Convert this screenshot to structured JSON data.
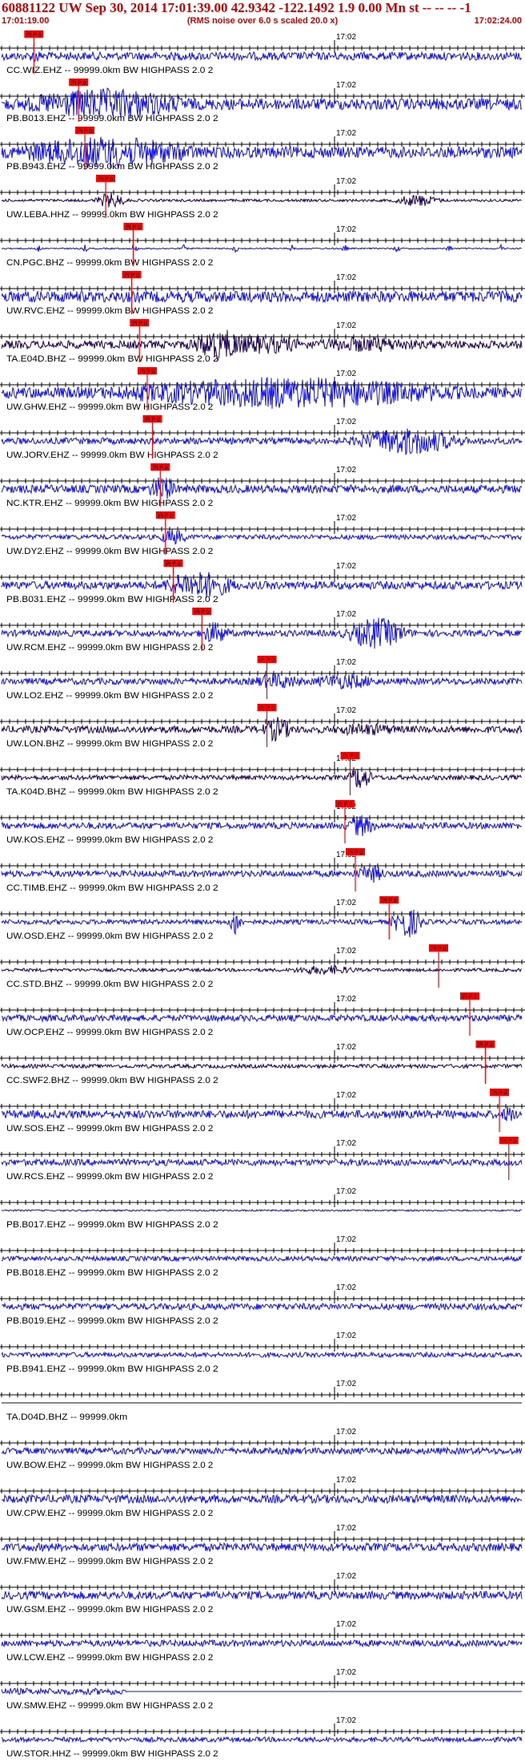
{
  "header": {
    "title": "60881122 UW Sep 30, 2014 17:01:39.00   42.9342 -122.1492  1.9 0.00 Mn st -- -- -- -1",
    "start_time": "17:01:19.00",
    "noise_note": "(RMS noise over 6.0 s scaled 20.0 x)",
    "end_time": "17:02:24.00"
  },
  "chart_data": {
    "type": "line",
    "title": "60881122 UW Sep 30, 2014 17:01:39.00   42.9342 -122.1492  1.9 0.00 Mn st -- -- -- -1",
    "x_start": "17:01:19.00",
    "x_end": "17:02:24.00",
    "x_mark": "17:02",
    "pick_label": "Pi P 0",
    "colors": {
      "trace": "#1010ee",
      "trace_dark": "#1a0055",
      "pick": "#ff0000",
      "axis": "#000000",
      "text": "#000000"
    },
    "traces": [
      {
        "label": "CC.WIZ.EHZ -- 99999.0km BW HIGHPASS 2.0 2",
        "color": "blue",
        "pick": 0.062,
        "amp": 0.25,
        "events": [
          [
            0.065,
            0.45,
            0.01
          ]
        ]
      },
      {
        "label": "PB.B013.EHZ -- 99999.0km BW HIGHPASS 2.0 2",
        "color": "blue",
        "pick": 0.148,
        "amp": 0.35,
        "events": [
          [
            0.2,
            1.0,
            0.12
          ]
        ]
      },
      {
        "label": "PB.B943.EHZ -- 99999.0km BW HIGHPASS 2.0 2",
        "color": "blue",
        "pick": 0.16,
        "amp": 0.35,
        "events": [
          [
            0.2,
            1.0,
            0.13
          ]
        ]
      },
      {
        "label": "UW.LEBA.HHZ -- 99999.0km BW HIGHPASS 2.0 2",
        "color": "dark",
        "pick": 0.2,
        "amp": 0.08,
        "events": [
          [
            0.21,
            0.5,
            0.02
          ],
          [
            0.8,
            0.4,
            0.03
          ]
        ]
      },
      {
        "label": "CN.PGC.BHZ -- 99999.0km BW HIGHPASS 2.0 2",
        "color": "blue",
        "pick": 0.253,
        "amp": 0.04,
        "events": [
          [
            0.07,
            0.25,
            0.004
          ],
          [
            0.16,
            0.25,
            0.004
          ],
          [
            0.255,
            0.35,
            0.004
          ],
          [
            0.35,
            0.25,
            0.004
          ],
          [
            0.45,
            0.25,
            0.004
          ],
          [
            0.56,
            0.25,
            0.004
          ],
          [
            0.66,
            0.25,
            0.004
          ],
          [
            0.76,
            0.25,
            0.004
          ],
          [
            0.86,
            0.25,
            0.004
          ],
          [
            0.96,
            0.25,
            0.004
          ]
        ]
      },
      {
        "label": "UW.RVC.EHZ -- 99999.0km BW HIGHPASS 2.0 2",
        "color": "blue",
        "pick": 0.25,
        "amp": 0.35,
        "events": []
      },
      {
        "label": "TA.E04D.BHZ -- 99999.0km BW HIGHPASS 2.0 2",
        "color": "dark",
        "pick": 0.265,
        "amp": 0.25,
        "events": [
          [
            0.42,
            1.0,
            0.04
          ],
          [
            0.5,
            0.6,
            0.07
          ],
          [
            0.7,
            0.5,
            0.09
          ]
        ]
      },
      {
        "label": "UW.GHW.EHZ -- 99999.0km BW HIGHPASS 2.0 2",
        "color": "blue",
        "pick": 0.28,
        "amp": 0.35,
        "events": [
          [
            0.55,
            1.0,
            0.25
          ]
        ]
      },
      {
        "label": "UW.JORV.EHZ -- 99999.0km BW HIGHPASS 2.0 2",
        "color": "blue",
        "pick": 0.29,
        "amp": 0.2,
        "events": [
          [
            0.78,
            0.9,
            0.07
          ]
        ]
      },
      {
        "label": "NC.KTR.EHZ -- 99999.0km BW HIGHPASS 2.0 2",
        "color": "blue",
        "pick": 0.305,
        "amp": 0.25,
        "events": [
          [
            0.31,
            0.8,
            0.02
          ]
        ]
      },
      {
        "label": "UW.DY2.EHZ -- 99999.0km BW HIGHPASS 2.0 2",
        "color": "blue",
        "pick": 0.315,
        "amp": 0.15,
        "events": [
          [
            0.33,
            0.5,
            0.02
          ]
        ]
      },
      {
        "label": "PB.B031.EHZ -- 99999.0km BW HIGHPASS 2.0 2",
        "color": "blue",
        "pick": 0.33,
        "amp": 0.25,
        "events": [
          [
            0.38,
            0.9,
            0.05
          ]
        ]
      },
      {
        "label": "UW.RCM.EHZ -- 99999.0km BW HIGHPASS 2.0 2",
        "color": "blue",
        "pick": 0.385,
        "amp": 0.2,
        "events": [
          [
            0.41,
            0.7,
            0.02
          ],
          [
            0.72,
            1.0,
            0.04
          ]
        ]
      },
      {
        "label": "UW.LO2.EHZ -- 99999.0km BW HIGHPASS 2.0 2",
        "color": "blue",
        "pick": 0.51,
        "amp": 0.2,
        "events": [
          [
            0.53,
            0.5,
            0.04
          ],
          [
            0.66,
            0.5,
            0.05
          ]
        ]
      },
      {
        "label": "UW.LON.BHZ -- 99999.0km BW HIGHPASS 2.0 2",
        "color": "dark",
        "pick": 0.51,
        "amp": 0.22,
        "events": [
          [
            0.53,
            0.8,
            0.02
          ],
          [
            0.7,
            0.4,
            0.06
          ]
        ]
      },
      {
        "label": "TA.K04D.BHZ -- 99999.0km BW HIGHPASS 2.0 2",
        "color": "dark",
        "pick": 0.67,
        "amp": 0.15,
        "events": [
          [
            0.69,
            0.8,
            0.015
          ]
        ]
      },
      {
        "label": "UW.KOS.EHZ -- 99999.0km BW HIGHPASS 2.0 2",
        "color": "blue",
        "pick": 0.66,
        "amp": 0.2,
        "events": [
          [
            0.69,
            0.7,
            0.02
          ]
        ]
      },
      {
        "label": "CC.TIMB.EHZ -- 99999.0km BW HIGHPASS 2.0 2",
        "color": "blue",
        "pick": 0.68,
        "amp": 0.2,
        "events": [
          [
            0.71,
            0.6,
            0.02
          ]
        ]
      },
      {
        "label": "UW.OSD.EHZ -- 99999.0km BW HIGHPASS 2.0 2",
        "color": "blue",
        "pick": 0.745,
        "amp": 0.15,
        "events": [
          [
            0.45,
            0.9,
            0.008
          ],
          [
            0.78,
            1.0,
            0.02
          ]
        ]
      },
      {
        "label": "CC.STD.BHZ -- 99999.0km BW HIGHPASS 2.0 2",
        "color": "dark",
        "pick": 0.84,
        "amp": 0.1,
        "events": [
          [
            0.62,
            0.3,
            0.05
          ]
        ]
      },
      {
        "label": "UW.OCP.EHZ -- 99999.0km BW HIGHPASS 2.0 2",
        "color": "blue",
        "pick": 0.9,
        "amp": 0.2,
        "events": []
      },
      {
        "label": "CC.SWF2.BHZ -- 99999.0km BW HIGHPASS 2.0 2",
        "color": "dark",
        "pick": 0.93,
        "amp": 0.12,
        "events": []
      },
      {
        "label": "UW.SOS.EHZ -- 99999.0km BW HIGHPASS 2.0 2",
        "color": "blue",
        "pick": 0.957,
        "amp": 0.25,
        "events": [
          [
            0.975,
            0.6,
            0.01
          ]
        ]
      },
      {
        "label": "UW.RCS.EHZ -- 99999.0km BW HIGHPASS 2.0 2",
        "color": "blue",
        "pick": 0.975,
        "amp": 0.2,
        "events": []
      },
      {
        "label": "PB.B017.EHZ -- 99999.0km BW HIGHPASS 2.0 2",
        "color": "blue",
        "pick": null,
        "amp": 0.05,
        "events": []
      },
      {
        "label": "PB.B018.EHZ -- 99999.0km BW HIGHPASS 2.0 2",
        "color": "blue",
        "pick": null,
        "amp": 0.15,
        "events": []
      },
      {
        "label": "PB.B019.EHZ -- 99999.0km BW HIGHPASS 2.0 2",
        "color": "blue",
        "pick": null,
        "amp": 0.2,
        "events": []
      },
      {
        "label": "PB.B941.EHZ -- 99999.0km BW HIGHPASS 2.0 2",
        "color": "blue",
        "pick": null,
        "amp": 0.15,
        "events": []
      },
      {
        "label": "TA.D04D.BHZ -- 99999.0km",
        "color": "dark",
        "pick": null,
        "amp": 0.0,
        "events": []
      },
      {
        "label": "UW.BOW.EHZ -- 99999.0km BW HIGHPASS 2.0 2",
        "color": "blue",
        "pick": null,
        "amp": 0.2,
        "events": []
      },
      {
        "label": "UW.CPW.EHZ -- 99999.0km BW HIGHPASS 2.0 2",
        "color": "blue",
        "pick": null,
        "amp": 0.25,
        "events": []
      },
      {
        "label": "UW.FMW.EHZ -- 99999.0km BW HIGHPASS 2.0 2",
        "color": "blue",
        "pick": null,
        "amp": 0.25,
        "events": []
      },
      {
        "label": "UW.GSM.EHZ -- 99999.0km BW HIGHPASS 2.0 2",
        "color": "blue",
        "pick": null,
        "amp": 0.25,
        "events": []
      },
      {
        "label": "UW.LCW.EHZ -- 99999.0km BW HIGHPASS 2.0 2",
        "color": "blue",
        "pick": null,
        "amp": 0.2,
        "events": []
      },
      {
        "label": "UW.SMW.EHZ -- 99999.0km BW HIGHPASS 2.0 2",
        "color": "blue",
        "pick": null,
        "amp": 0.2,
        "cut": 0.24,
        "events": []
      },
      {
        "label": "UW.STOR.HHZ -- 99999.0km BW HIGHPASS 2.0 2",
        "color": "blue",
        "pick": null,
        "amp": 0.15,
        "events": []
      }
    ]
  }
}
